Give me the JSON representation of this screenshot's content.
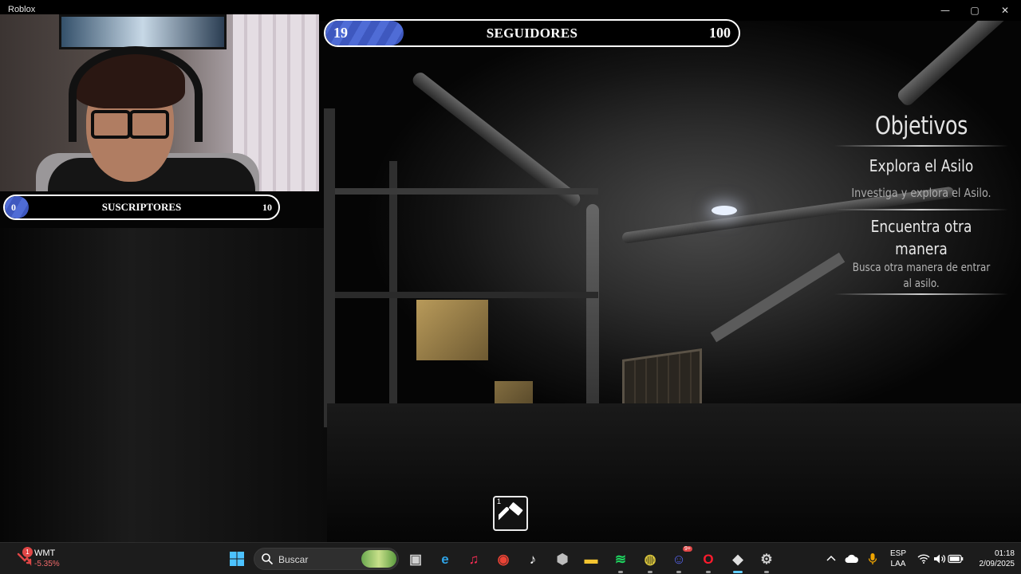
{
  "window": {
    "title": "Roblox",
    "controls": {
      "minimize": "—",
      "maximize": "▢",
      "close": "✕"
    }
  },
  "hud": {
    "followers": {
      "label": "SEGUIDORES",
      "current": "19",
      "goal": "100",
      "progress": 0.19
    },
    "subscribers": {
      "label": "SUSCRIPTORES",
      "current": "0",
      "goal": "10",
      "progress": 0.0
    }
  },
  "objectives": {
    "title": "Objetivos",
    "items": [
      {
        "title": "Explora el Asilo",
        "description": "Investiga y explora el Asilo."
      },
      {
        "title": "Encuentra otra manera",
        "description": "Busca otra manera de entrar al asilo."
      }
    ]
  },
  "hotbar": {
    "slot_key": "1",
    "item_icon": "hammer-icon"
  },
  "taskbar": {
    "stock": {
      "badge": "1",
      "ticker": "WMT",
      "change": "-5.35%"
    },
    "search_placeholder": "Buscar",
    "apps": [
      {
        "name": "task-view",
        "icon": "task-view-icon",
        "color": "#cfcfcf",
        "running": false
      },
      {
        "name": "edge",
        "icon": "edge-icon",
        "color": "#2fa3e6",
        "running": false
      },
      {
        "name": "music",
        "icon": "music-icon",
        "color": "#fa2d55",
        "running": false
      },
      {
        "name": "chrome",
        "icon": "chrome-icon",
        "color": "#ea4335",
        "running": false
      },
      {
        "name": "tiktok",
        "icon": "tiktok-icon",
        "color": "#ffffff",
        "running": false
      },
      {
        "name": "obs",
        "icon": "obs-icon",
        "color": "#bdbdbd",
        "running": false
      },
      {
        "name": "file-explorer",
        "icon": "folder-icon",
        "color": "#f4c430",
        "running": false
      },
      {
        "name": "spotify",
        "icon": "spotify-icon",
        "color": "#1ed760",
        "running": true
      },
      {
        "name": "app-yellow",
        "icon": "globe-icon",
        "color": "#d6c23a",
        "running": true
      },
      {
        "name": "discord",
        "icon": "discord-icon",
        "color": "#5865f2",
        "running": true
      },
      {
        "name": "opera",
        "icon": "opera-icon",
        "color": "#ff1b2d",
        "running": true
      },
      {
        "name": "roblox",
        "icon": "roblox-icon",
        "color": "#e0e0e0",
        "running": true
      },
      {
        "name": "steam-like",
        "icon": "gear-icon",
        "color": "#cfcfcf",
        "running": true
      }
    ],
    "discord_badge": "9+",
    "lang": {
      "line1": "ESP",
      "line2": "LAA"
    },
    "clock": {
      "time": "01:18",
      "date": "2/09/2025"
    }
  }
}
